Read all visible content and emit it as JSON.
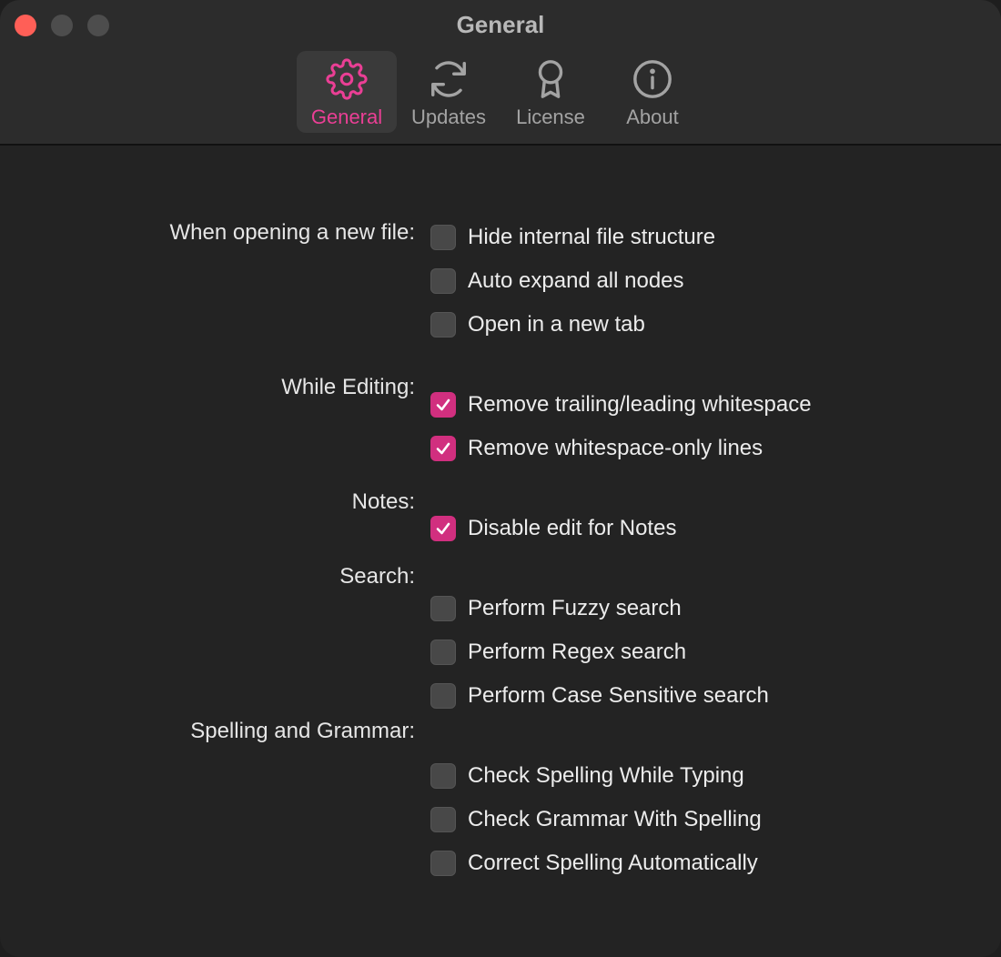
{
  "window": {
    "title": "General"
  },
  "toolbar": {
    "tabs": [
      {
        "label": "General",
        "icon": "gear-icon",
        "active": true
      },
      {
        "label": "Updates",
        "icon": "refresh-icon",
        "active": false
      },
      {
        "label": "License",
        "icon": "ribbon-icon",
        "active": false
      },
      {
        "label": "About",
        "icon": "info-icon",
        "active": false
      }
    ]
  },
  "colors": {
    "accent": "#ea3f95",
    "checkbox_checked": "#d12f7f",
    "background": "#232323",
    "titlebar": "#2c2c2c"
  },
  "sections": {
    "open_file": {
      "label": "When opening a new file:",
      "options": [
        {
          "label": "Hide internal file structure",
          "checked": false
        },
        {
          "label": "Auto expand all nodes",
          "checked": false
        },
        {
          "label": "Open in a new tab",
          "checked": false
        }
      ]
    },
    "editing": {
      "label": "While Editing:",
      "options": [
        {
          "label": "Remove trailing/leading whitespace",
          "checked": true
        },
        {
          "label": "Remove whitespace-only lines",
          "checked": true
        }
      ]
    },
    "notes": {
      "label": "Notes:",
      "options": [
        {
          "label": "Disable edit for Notes",
          "checked": true
        }
      ]
    },
    "search": {
      "label": "Search:",
      "options": [
        {
          "label": "Perform Fuzzy search",
          "checked": false
        },
        {
          "label": "Perform Regex search",
          "checked": false
        },
        {
          "label": "Perform Case Sensitive search",
          "checked": false
        }
      ]
    },
    "spelling": {
      "label": "Spelling and Grammar:",
      "options": [
        {
          "label": "Check Spelling While Typing",
          "checked": false
        },
        {
          "label": "Check Grammar With Spelling",
          "checked": false
        },
        {
          "label": "Correct Spelling Automatically",
          "checked": false
        }
      ]
    }
  }
}
